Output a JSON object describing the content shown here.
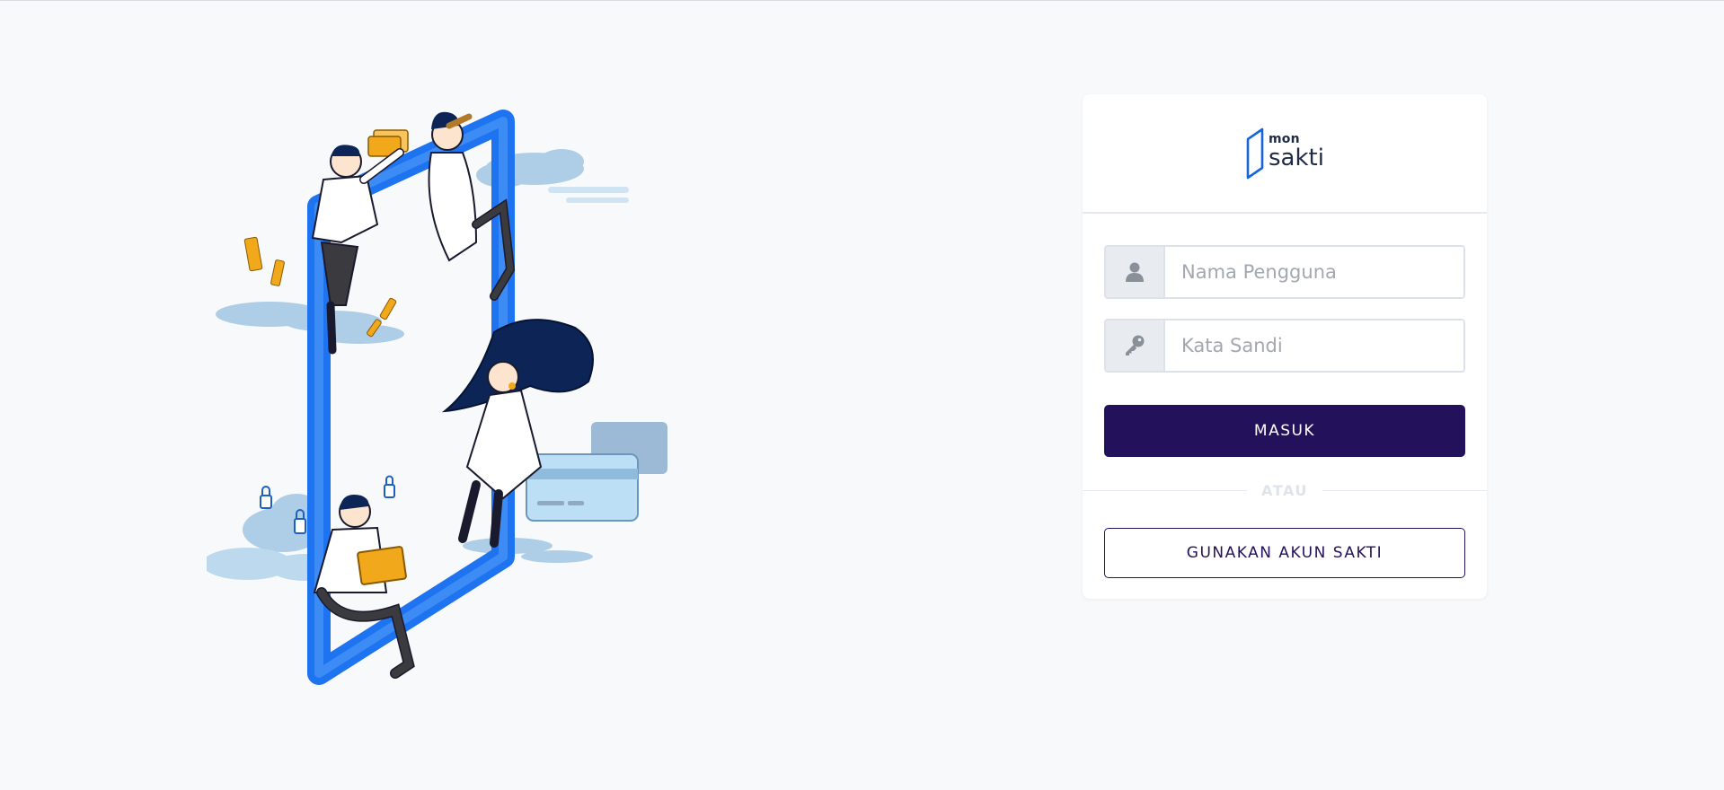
{
  "login": {
    "logo": {
      "small": "mon",
      "big": "sakti"
    },
    "username": {
      "placeholder": "Nama Pengguna",
      "value": ""
    },
    "password": {
      "placeholder": "Kata Sandi",
      "value": ""
    },
    "submit_label": "MASUK",
    "divider_label": "ATAU",
    "alt_login_label": "GUNAKAN AKUN SAKTI"
  },
  "icons": {
    "user": "user-icon",
    "key": "key-icon"
  },
  "colors": {
    "primary": "#23115c",
    "background": "#f8f9fb",
    "logo_blue": "#1565d8",
    "illustration_blue": "#1e74f0",
    "illustration_navy": "#0d2457",
    "illustration_yellow": "#f1a81a",
    "cloud_blue": "#aecde6"
  }
}
